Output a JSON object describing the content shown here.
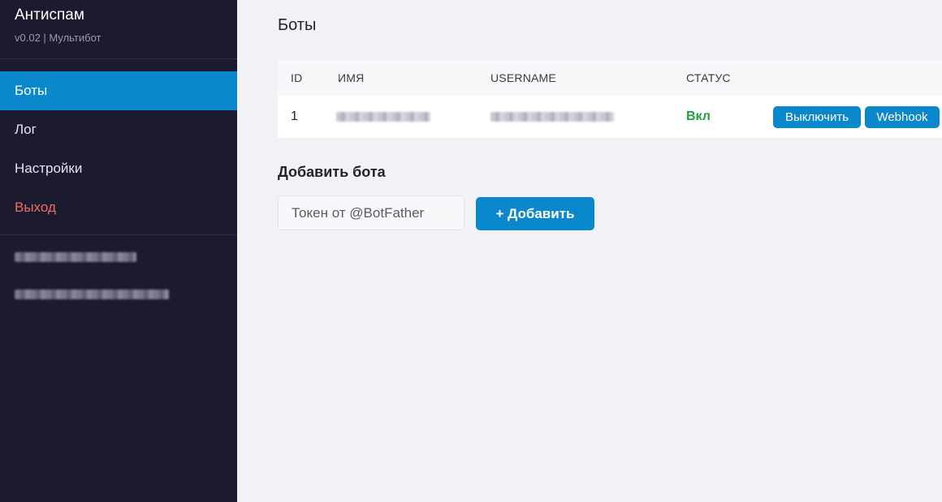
{
  "sidebar": {
    "brand_title": "Антиспам",
    "brand_subtitle": "v0.02 | Мультибот",
    "nav_items": [
      {
        "label": "Боты",
        "active": true
      },
      {
        "label": "Лог",
        "active": false
      },
      {
        "label": "Настройки",
        "active": false
      },
      {
        "label": "Выход",
        "active": false
      }
    ]
  },
  "main": {
    "page_title": "Боты",
    "table": {
      "headers": [
        "ID",
        "ИМЯ",
        "USERNAME",
        "СТАТУС"
      ],
      "rows": [
        {
          "id": "1",
          "status": "Вкл",
          "disable_label": "Выключить",
          "webhook_label": "Webhook"
        }
      ]
    },
    "add_bot": {
      "title": "Добавить бота",
      "token_placeholder": "Токен от @BotFather",
      "token_value": "",
      "add_label": "+ Добавить"
    }
  },
  "colors": {
    "sidebar_bg": "#1b1a2e",
    "accent": "#0b87cc",
    "status_on": "#1fa23c",
    "logout": "#ef6b6b",
    "page_bg": "#f1f2f6"
  }
}
